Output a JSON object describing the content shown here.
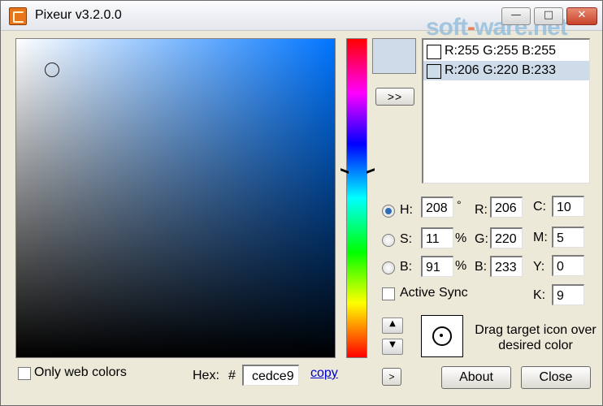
{
  "window": {
    "title": "Pixeur v3.2.0.0",
    "watermark": {
      "part1": "soft",
      "dot": "-",
      "part2": "ware.net"
    },
    "controls": {
      "minimize": "—",
      "maximize": "□",
      "close": "✕"
    }
  },
  "add_button": {
    "label": ">>"
  },
  "history": [
    {
      "label": "R:255 G:255 B:255",
      "swatch": "#ffffff",
      "selected": false
    },
    {
      "label": "R:206 G:220 B:233",
      "swatch": "#cedce9",
      "selected": true
    }
  ],
  "hsb": {
    "h": {
      "label": "H:",
      "value": "208",
      "unit": "°"
    },
    "s": {
      "label": "S:",
      "value": "11",
      "unit": "%"
    },
    "b": {
      "label": "B:",
      "value": "91",
      "unit": "%"
    }
  },
  "rgb": {
    "r": {
      "label": "R:",
      "value": "206"
    },
    "g": {
      "label": "G:",
      "value": "220"
    },
    "b": {
      "label": "B:",
      "value": "233"
    }
  },
  "cmyk": {
    "c": {
      "label": "C:",
      "value": "10"
    },
    "m": {
      "label": "M:",
      "value": "5"
    },
    "y": {
      "label": "Y:",
      "value": "0"
    },
    "k": {
      "label": "K:",
      "value": "9"
    }
  },
  "active_sync": {
    "label": "Active Sync",
    "checked": false
  },
  "only_web_colors": {
    "label": "Only web colors",
    "checked": false
  },
  "hex": {
    "label": "Hex:",
    "prefix": "#",
    "value": "cedce9",
    "copy_label": "copy"
  },
  "drag_hint": "Drag target icon over desired color",
  "buttons": {
    "about": "About",
    "close": "Close",
    "more": ">"
  },
  "colors": {
    "current": "#cedce9",
    "hue_base": "#0075ff"
  }
}
